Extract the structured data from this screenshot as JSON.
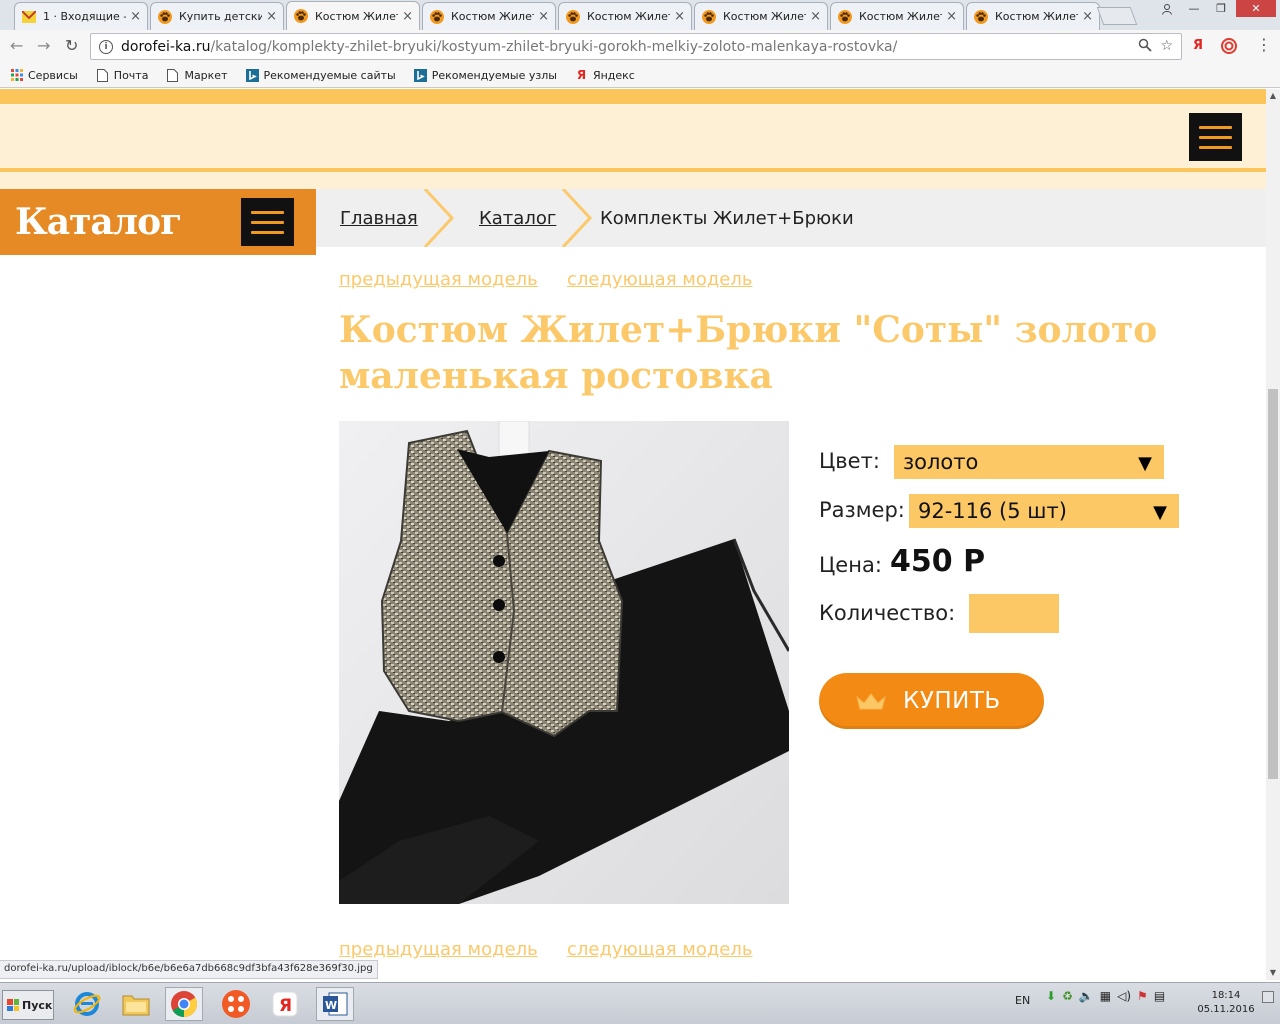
{
  "browser": {
    "tabs": [
      {
        "title": "1 · Входящие -",
        "icon": "mail-icon",
        "active": false
      },
      {
        "title": "Купить детски",
        "icon": "paw-icon",
        "active": false
      },
      {
        "title": "Костюм Жилет",
        "icon": "paw-icon",
        "active": true
      },
      {
        "title": "Костюм Жилет",
        "icon": "paw-icon",
        "active": false
      },
      {
        "title": "Костюм Жилет",
        "icon": "paw-icon",
        "active": false
      },
      {
        "title": "Костюм Жилет",
        "icon": "paw-icon",
        "active": false
      },
      {
        "title": "Костюм Жилет",
        "icon": "paw-icon",
        "active": false
      },
      {
        "title": "Костюм Жилет",
        "icon": "paw-icon",
        "active": false
      }
    ],
    "url_host": "dorofei-ka.ru",
    "url_path": "/katalog/komplekty-zhilet-bryuki/kostyum-zhilet-bryuki-gorokh-melkiy-zoloto-malenkaya-rostovka/",
    "bookmarks": [
      {
        "label": "Сервисы",
        "icon": "apps-grid-icon"
      },
      {
        "label": "Почта",
        "icon": "page-icon"
      },
      {
        "label": "Маркет",
        "icon": "page-icon"
      },
      {
        "label": "Рекомендуемые сайты",
        "icon": "bing-icon"
      },
      {
        "label": "Рекомендуемые узлы",
        "icon": "bing-icon"
      },
      {
        "label": "Яндекс",
        "icon": "yandex-icon"
      }
    ],
    "status_url": "dorofei-ka.ru/upload/iblock/b6e/b6e6a7db668c9df3bfa43f628e369f30.jpg"
  },
  "site": {
    "colors": {
      "accent": "#e68a25",
      "light_accent": "#fcc96a",
      "button": "#f38a14",
      "field": "#fcc865"
    },
    "catalog_label": "Каталог",
    "breadcrumbs": [
      {
        "label": "Главная",
        "link": true
      },
      {
        "label": "Каталог",
        "link": true
      },
      {
        "label": "Комплекты Жилет+Брюки",
        "link": false
      }
    ],
    "prev_model": "предыдущая модель",
    "next_model": "следующая модель",
    "product": {
      "title": "Костюм Жилет+Брюки \"Соты\" золото маленькая ростовка",
      "color_label": "Цвет:",
      "color_value": "золото",
      "size_label": "Размер:",
      "size_value": "92-116 (5 шт)",
      "price_label": "Цена:",
      "price_value": "450 Р",
      "qty_label": "Количество:",
      "qty_value": "",
      "buy_label": "КУПИТЬ"
    }
  },
  "taskbar": {
    "start_label": "Пуск",
    "apps": [
      "internet-explorer-icon",
      "file-explorer-icon",
      "chrome-icon",
      "media-player-icon",
      "yandex-browser-icon",
      "word-icon"
    ],
    "language": "EN",
    "time": "18:14",
    "date": "05.11.2016"
  }
}
